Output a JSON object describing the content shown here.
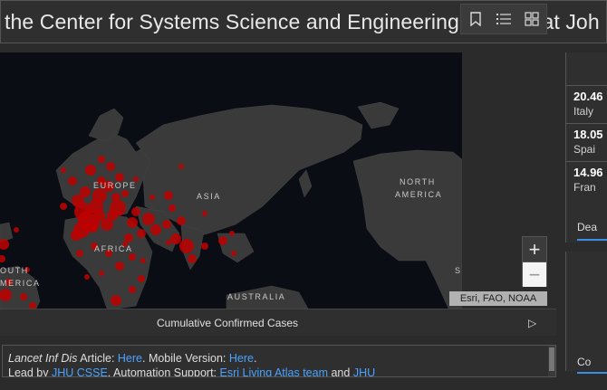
{
  "header": {
    "title": "the Center for Systems Science and Engineering (CSSE) at Joh"
  },
  "map": {
    "labels": {
      "europe": "EUROPE",
      "asia": "ASIA",
      "africa": "AFRICA",
      "north_america_1": "NORTH",
      "north_america_2": "AMERICA",
      "south_america_1": "OUTH",
      "south_america_2": "MERICA",
      "australia": "AUSTRALIA",
      "s_cut": "S"
    },
    "attribution": "Esri, FAO, NOAA",
    "zoom_in": "+",
    "zoom_out": "−",
    "footer_tab": "Cumulative Confirmed Cases",
    "footer_next": "▷",
    "colors": {
      "cases": "#c00000",
      "land": "#3a3a3a",
      "ocean": "#0a0e14"
    }
  },
  "info": {
    "l1_a": "Lancet Inf Dis",
    "l1_b": " Article: ",
    "l1_link1": "Here",
    "l1_c": ". Mobile Version: ",
    "l1_link2": "Here",
    "l1_d": ".",
    "l2_a": "Lead by ",
    "l2_link1": "JHU CSSE",
    "l2_b": ". Automation Support: ",
    "l2_link2": "Esri Living Atlas team",
    "l2_c": " and ",
    "l2_link3": "JHU"
  },
  "right_panel": {
    "items": [
      {
        "value": "20.46",
        "label": "Italy"
      },
      {
        "value": "18.05",
        "label": "Spai"
      },
      {
        "value": "14.96",
        "label": "Fran"
      }
    ],
    "tab": "Dea",
    "tab2": "Co"
  }
}
